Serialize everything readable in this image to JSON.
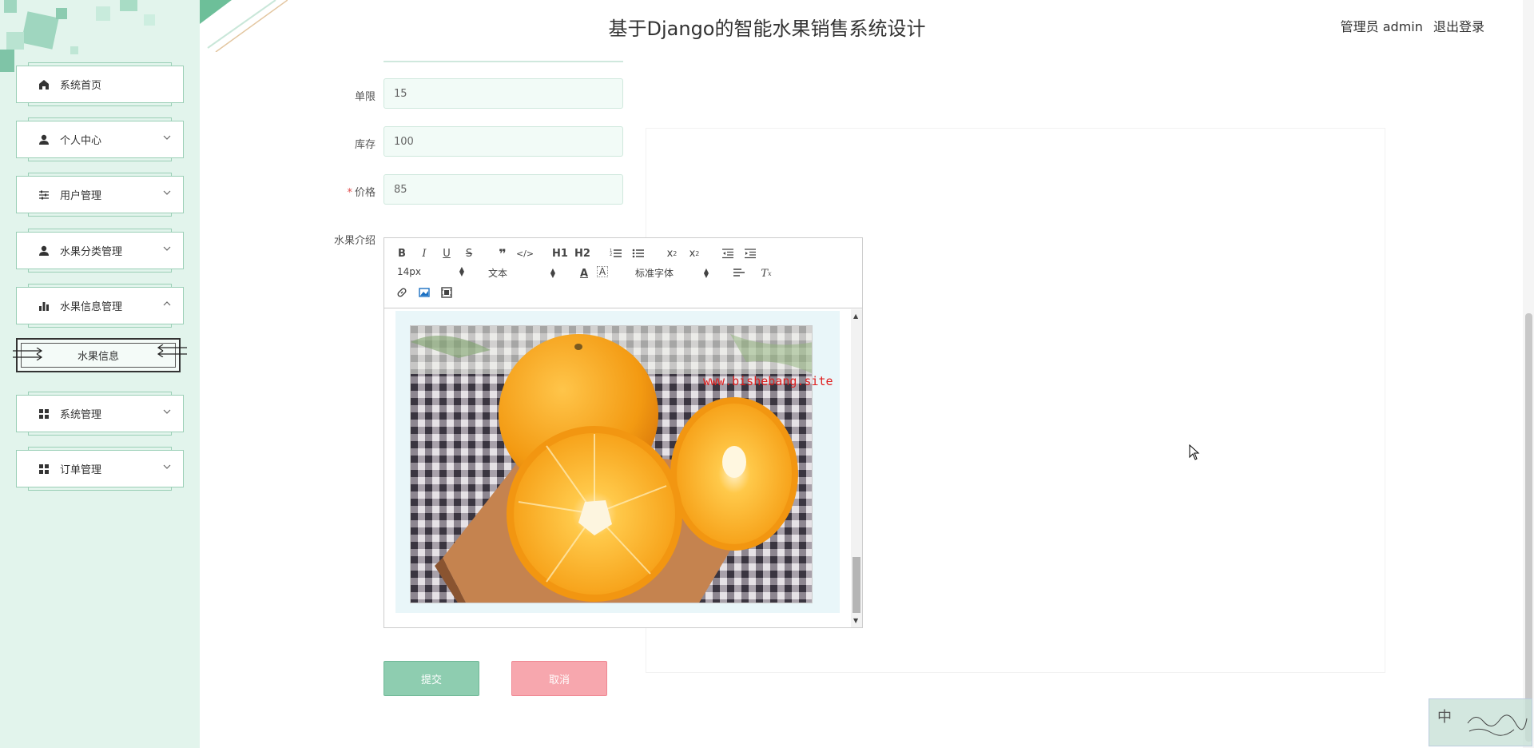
{
  "header": {
    "title": "基于Django的智能水果销售系统设计",
    "user_role": "管理员 admin",
    "logout": "退出登录"
  },
  "sidebar": {
    "items": [
      {
        "label": "系统首页",
        "icon": "home-icon"
      },
      {
        "label": "个人中心",
        "icon": "user-icon"
      },
      {
        "label": "用户管理",
        "icon": "sliders-icon"
      },
      {
        "label": "水果分类管理",
        "icon": "user-icon"
      },
      {
        "label": "水果信息管理",
        "icon": "bar-chart-icon"
      },
      {
        "label": "系统管理",
        "icon": "grid-icon"
      },
      {
        "label": "订单管理",
        "icon": "grid-icon"
      }
    ],
    "sub_item": "水果信息"
  },
  "form": {
    "limit_label": "单限",
    "limit_value": "15",
    "stock_label": "库存",
    "stock_value": "100",
    "price_required": "*",
    "price_label": "价格",
    "price_value": "85",
    "intro_label": "水果介绍"
  },
  "editor": {
    "font_size": "14px",
    "block_type": "文本",
    "font_family": "标准字体",
    "h1": "H1",
    "h2": "H2"
  },
  "watermark": "www.bishebang.site",
  "buttons": {
    "submit": "提交",
    "cancel": "取消"
  },
  "ime": {
    "zh": "中"
  },
  "colors": {
    "sidebar_bg": "#e2f4ec",
    "accent": "#8ecdb0",
    "cancel": "#f7a7ae",
    "watermark": "#e02020"
  }
}
